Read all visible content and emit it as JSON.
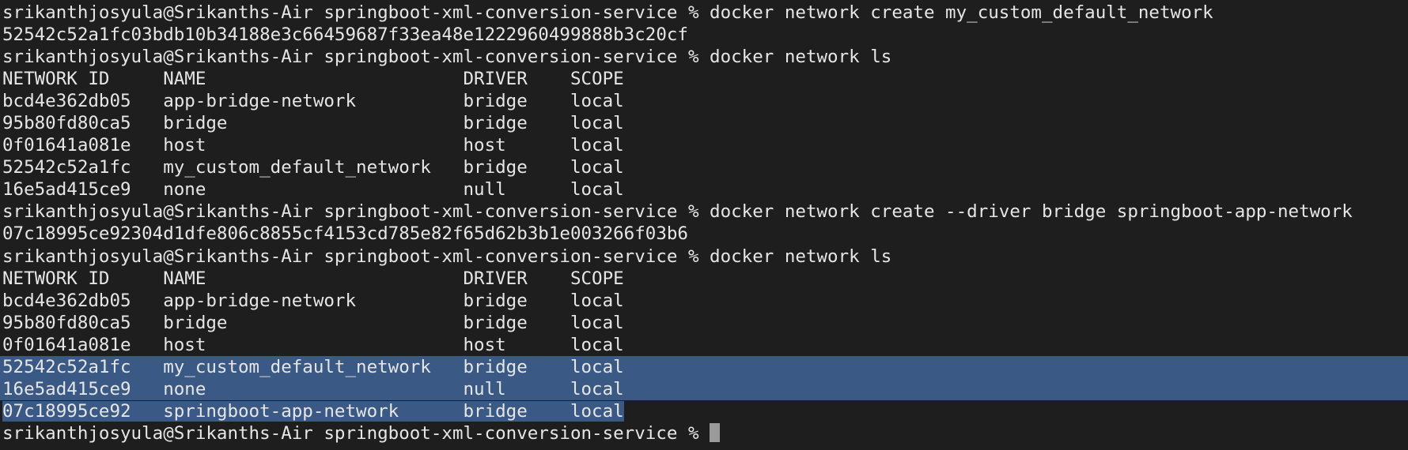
{
  "prompt": "srikanthjosyula@Srikanths-Air springboot-xml-conversion-service % ",
  "lines": [
    {
      "kind": "prompt",
      "text": "srikanthjosyula@Srikanths-Air springboot-xml-conversion-service % docker network create my_custom_default_network"
    },
    {
      "kind": "output",
      "text": "52542c52a1fc03bdb10b34188e3c66459687f33ea48e1222960499888b3c20cf"
    },
    {
      "kind": "prompt",
      "text": "srikanthjosyula@Srikanths-Air springboot-xml-conversion-service % docker network ls"
    },
    {
      "kind": "header",
      "text": "NETWORK ID     NAME                        DRIVER    SCOPE"
    },
    {
      "kind": "row",
      "text": "bcd4e362db05   app-bridge-network          bridge    local"
    },
    {
      "kind": "row",
      "text": "95b80fd80ca5   bridge                      bridge    local"
    },
    {
      "kind": "row",
      "text": "0f01641a081e   host                        host      local"
    },
    {
      "kind": "row",
      "text": "52542c52a1fc   my_custom_default_network   bridge    local"
    },
    {
      "kind": "row",
      "text": "16e5ad415ce9   none                        null      local"
    },
    {
      "kind": "prompt",
      "text": "srikanthjosyula@Srikanths-Air springboot-xml-conversion-service % docker network create --driver bridge springboot-app-network"
    },
    {
      "kind": "output",
      "text": "07c18995ce92304d1dfe806c8855cf4153cd785e82f65d62b3b1e003266f03b6"
    },
    {
      "kind": "prompt",
      "text": "srikanthjosyula@Srikanths-Air springboot-xml-conversion-service % docker network ls"
    },
    {
      "kind": "header",
      "text": "NETWORK ID     NAME                        DRIVER    SCOPE"
    },
    {
      "kind": "row",
      "text": "bcd4e362db05   app-bridge-network          bridge    local"
    },
    {
      "kind": "row",
      "text": "95b80fd80ca5   bridge                      bridge    local"
    },
    {
      "kind": "row",
      "text": "0f01641a081e   host                        host      local"
    },
    {
      "kind": "row-selected-full",
      "text": "52542c52a1fc   my_custom_default_network   bridge    local"
    },
    {
      "kind": "row-selected-full",
      "text": "16e5ad415ce9   none                        null      local"
    },
    {
      "kind": "row-selected-partial",
      "text": "07c18995ce92   springboot-app-network      bridge    local"
    }
  ],
  "colors": {
    "background": "#1e1e1e",
    "text": "#e6e6e6",
    "selection": "#3a5a85",
    "cursor": "#9a9a9a"
  }
}
